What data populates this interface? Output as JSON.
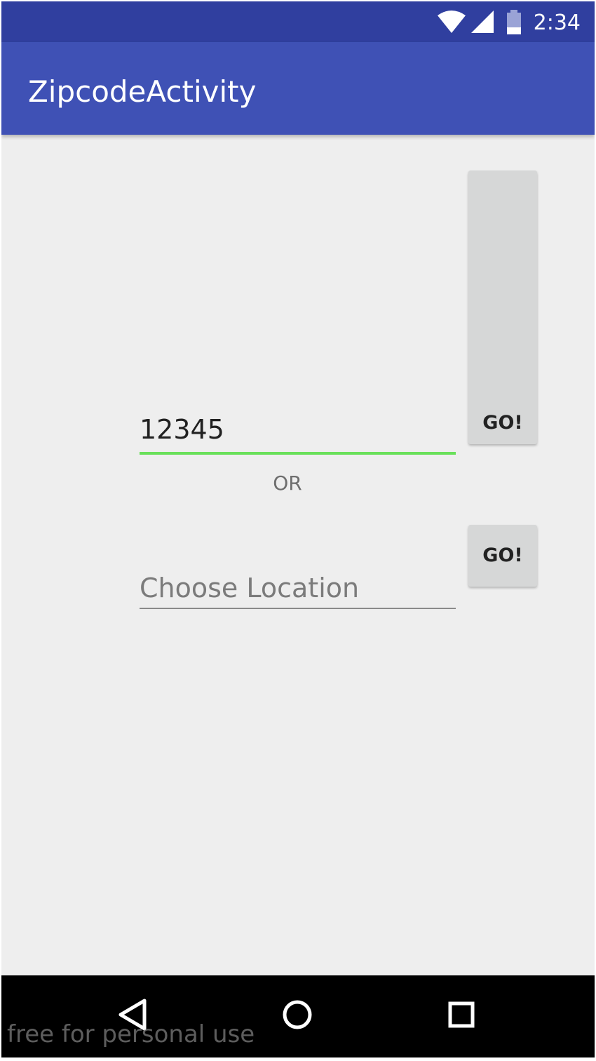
{
  "status_bar": {
    "time": "2:34",
    "icons": [
      "wifi-icon",
      "cell-signal-icon",
      "battery-icon"
    ]
  },
  "app_bar": {
    "title": "ZipcodeActivity"
  },
  "zip_field": {
    "value": "12345",
    "underline_color": "#69e05a"
  },
  "separator": {
    "label": "OR"
  },
  "location_field": {
    "placeholder": "Choose Location"
  },
  "zip_go_button": {
    "label": "GO!"
  },
  "location_go_button": {
    "label": "GO!"
  },
  "nav_bar": {
    "icons": [
      "back-icon",
      "home-icon",
      "recents-icon"
    ]
  },
  "watermark": {
    "text": "free for personal use"
  },
  "colors": {
    "status_bar": "#303f9f",
    "app_bar": "#3f51b5",
    "background": "#eeeeee",
    "button": "#d6d7d7"
  }
}
